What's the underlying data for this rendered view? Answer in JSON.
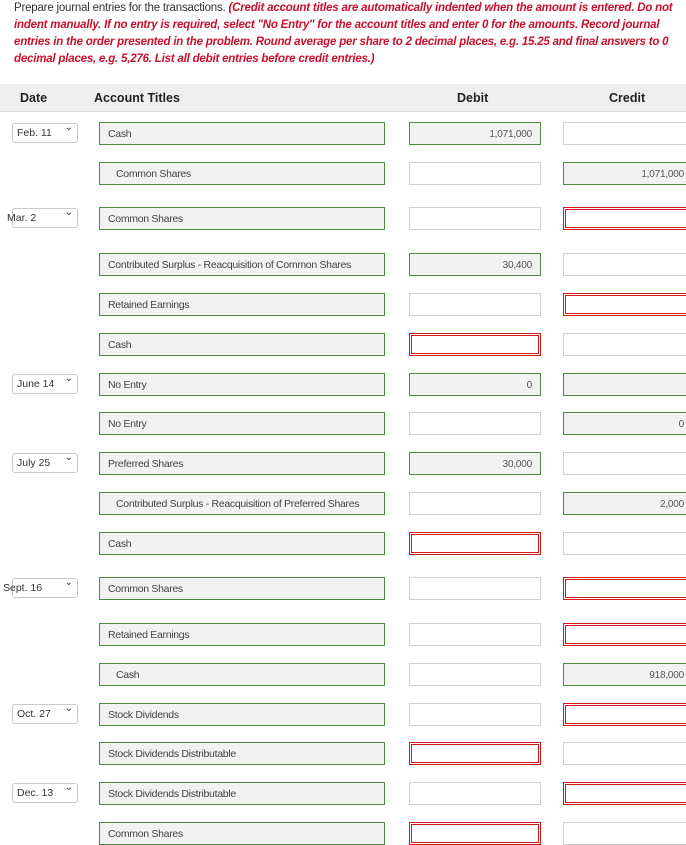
{
  "instructions": {
    "lead": "Prepare journal entries for the transactions. ",
    "note": "(Credit account titles are automatically indented when the amount is entered. Do not indent manually. If no entry is required, select \"No Entry\" for the account titles and enter 0 for the amounts. Record journal entries in the order presented in the problem. Round average per share to 2 decimal places, e.g. 15.25 and final answers to 0 decimal places, e.g. 5,276. List all debit entries before credit entries.)"
  },
  "headers": {
    "date": "Date",
    "account": "Account Titles",
    "debit": "Debit",
    "credit": "Credit"
  },
  "rows": [
    {
      "date": "Feb. 11",
      "account": "Cash",
      "debit": "1,071,000",
      "credit": ""
    },
    {
      "date": "",
      "account": "Common Shares",
      "debit": "",
      "credit": "1,071,000"
    },
    {
      "date": "Mar. 2",
      "account": "Common Shares",
      "debit": "",
      "credit": ""
    },
    {
      "date": "",
      "account": "Contributed Surplus - Reacquisition of Common Shares",
      "debit": "30,400",
      "credit": ""
    },
    {
      "date": "",
      "account": "Retained Earnings",
      "debit": "",
      "credit": ""
    },
    {
      "date": "",
      "account": "Cash",
      "debit": "",
      "credit": ""
    },
    {
      "date": "June 14",
      "account": "No Entry",
      "debit": "0",
      "credit": ""
    },
    {
      "date": "",
      "account": "No Entry",
      "debit": "",
      "credit": "0"
    },
    {
      "date": "July 25",
      "account": "Preferred Shares",
      "debit": "30,000",
      "credit": ""
    },
    {
      "date": "",
      "account": "Contributed Surplus - Reacquisition of Preferred Shares",
      "debit": "",
      "credit": "2,000"
    },
    {
      "date": "",
      "account": "Cash",
      "debit": "",
      "credit": ""
    },
    {
      "date": "Sept. 16",
      "account": "Common Shares",
      "debit": "",
      "credit": ""
    },
    {
      "date": "",
      "account": "Retained Earnings",
      "debit": "",
      "credit": ""
    },
    {
      "date": "",
      "account": "Cash",
      "debit": "",
      "credit": "918,000"
    },
    {
      "date": "Oct. 27",
      "account": "Stock Dividends",
      "debit": "",
      "credit": ""
    },
    {
      "date": "",
      "account": "Stock Dividends Distributable",
      "debit": "",
      "credit": ""
    },
    {
      "date": "Dec. 13",
      "account": "Stock Dividends Distributable",
      "debit": "",
      "credit": ""
    },
    {
      "date": "",
      "account": "Common Shares",
      "debit": "",
      "credit": ""
    }
  ]
}
